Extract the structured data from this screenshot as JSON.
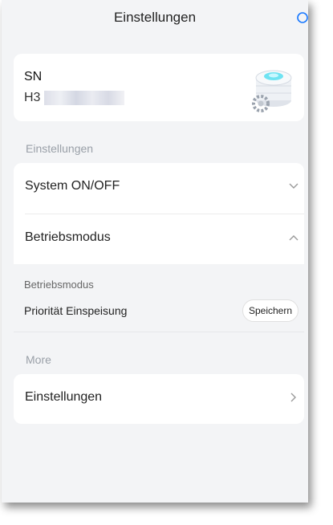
{
  "header": {
    "title": "Einstellungen",
    "refresh_icon": "refresh-icon"
  },
  "device": {
    "sn_label": "SN",
    "sn_prefix": "H3",
    "image_icon": "device-image"
  },
  "settings_section": {
    "label": "Einstellungen",
    "items": [
      {
        "label": "System ON/OFF",
        "state": "collapsed"
      },
      {
        "label": "Betriebsmodus",
        "state": "expanded"
      }
    ],
    "mode_detail": {
      "label": "Betriebsmodus",
      "value": "Priorität Einspeisung",
      "save_label": "Speichern"
    }
  },
  "more_section": {
    "label": "More",
    "items": [
      {
        "label": "Einstellungen"
      }
    ]
  },
  "colors": {
    "background": "#f3f4f6",
    "card": "#ffffff",
    "accent": "#1677ff"
  }
}
